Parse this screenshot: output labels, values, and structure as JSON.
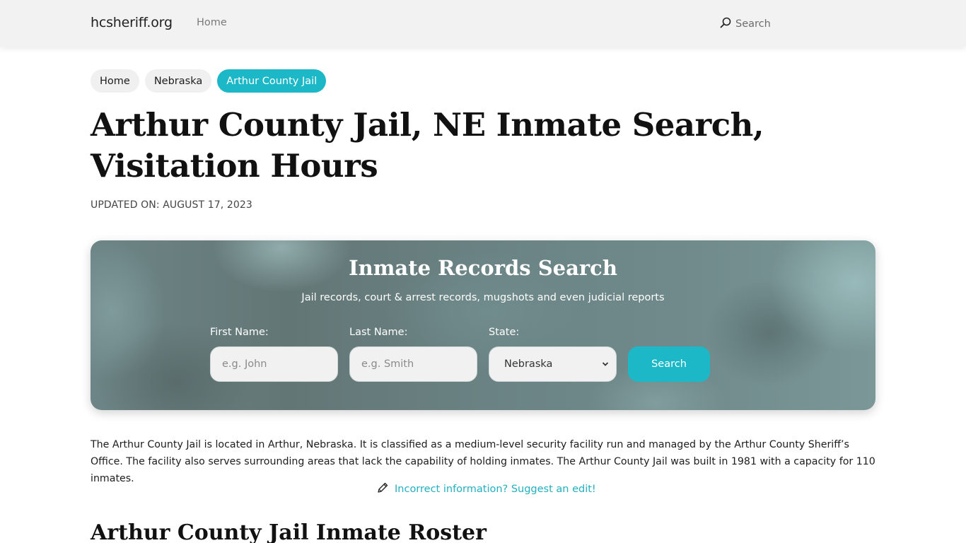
{
  "navbar": {
    "brand": "hcsheriff.org",
    "home_label": "Home",
    "search_label": "Search",
    "search_icon": "search-icon"
  },
  "breadcrumb": [
    {
      "label": "Home",
      "active": false
    },
    {
      "label": "Nebraska",
      "active": false
    },
    {
      "label": "Arthur County Jail",
      "active": true
    }
  ],
  "page": {
    "title": "Arthur County Jail, NE Inmate Search, Visitation Hours",
    "updated": "UPDATED ON: AUGUST 17, 2023"
  },
  "search_card": {
    "title": "Inmate Records Search",
    "subtitle": "Jail records, court & arrest records, mugshots and even judicial reports",
    "first_name": {
      "label": "First Name:",
      "placeholder": "e.g. John",
      "value": ""
    },
    "last_name": {
      "label": "Last Name:",
      "placeholder": "e.g. Smith",
      "value": ""
    },
    "state": {
      "label": "State:",
      "selected": "Nebraska",
      "icon": "chevron-down-icon"
    },
    "button_label": "Search"
  },
  "content": {
    "intro": "The Arthur County Jail is located in Arthur, Nebraska. It is classified as a medium-level security facility run and managed by the Arthur County Sheriff’s Office. The facility also serves surrounding areas that lack the capability of holding inmates. The Arthur County Jail was built in 1981 with a capacity for 110 inmates.",
    "edit_link": "Incorrect information? Suggest an edit!",
    "edit_icon": "pencil-icon",
    "section_title": "Arthur County Jail Inmate Roster"
  },
  "colors": {
    "accent": "#1cb8c7",
    "link": "#22b0be",
    "navbar_bg": "#f2f2f2"
  }
}
